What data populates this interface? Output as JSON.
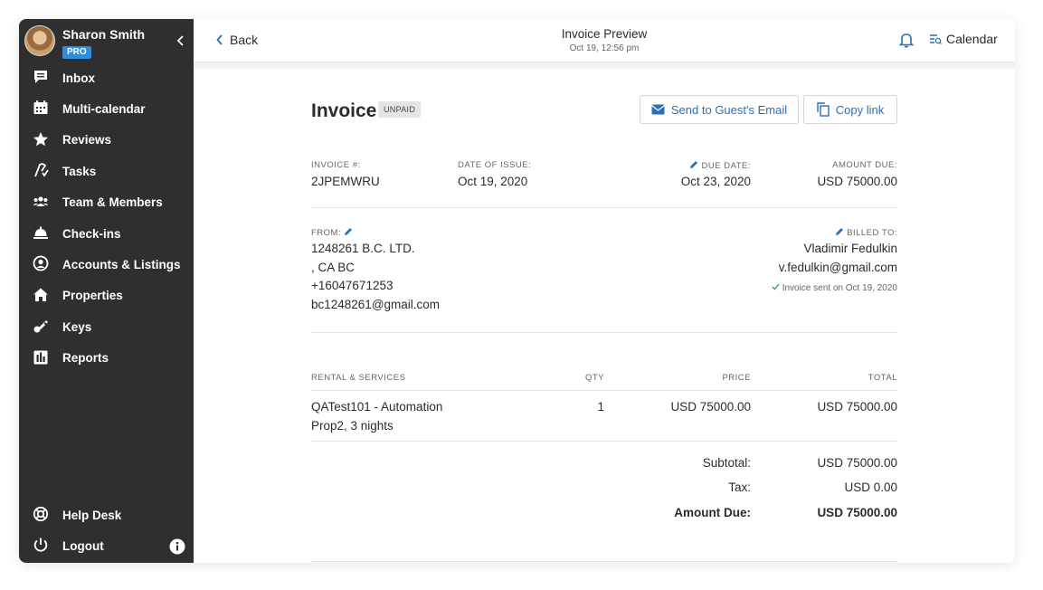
{
  "sidebar": {
    "user_name": "Sharon Smith",
    "plan_badge": "PRO",
    "items": [
      {
        "label": "Inbox",
        "icon": "chat-icon"
      },
      {
        "label": "Multi-calendar",
        "icon": "calendar-icon"
      },
      {
        "label": "Reviews",
        "icon": "star-icon"
      },
      {
        "label": "Tasks",
        "icon": "tasks-icon"
      },
      {
        "label": "Team & Members",
        "icon": "team-icon"
      },
      {
        "label": "Check-ins",
        "icon": "bell-concierge-icon"
      },
      {
        "label": "Accounts & Listings",
        "icon": "account-icon"
      },
      {
        "label": "Properties",
        "icon": "home-icon"
      },
      {
        "label": "Keys",
        "icon": "key-icon"
      },
      {
        "label": "Reports",
        "icon": "reports-icon"
      }
    ],
    "help_desk": "Help Desk",
    "logout": "Logout"
  },
  "topbar": {
    "back": "Back",
    "title": "Invoice Preview",
    "subtitle": "Oct 19, 12:56 pm",
    "calendar": "Calendar"
  },
  "invoice": {
    "title": "Invoice",
    "status": "UNPAID",
    "send_email_button": "Send to Guest's Email",
    "copy_link_button": "Copy link",
    "number_label": "INVOICE #:",
    "number": "2JPEMWRU",
    "issue_label": "DATE OF ISSUE:",
    "issue_date": "Oct 19, 2020",
    "due_label": "DUE DATE:",
    "due_date": "Oct 23, 2020",
    "amount_label": "AMOUNT DUE:",
    "amount": "USD 75000.00",
    "from_label": "FROM:",
    "from_lines": [
      "1248261 B.C. LTD.",
      ", CA BC",
      "+16047671253",
      "bc1248261@gmail.com"
    ],
    "billed_label": "BILLED TO:",
    "billed_name": "Vladimir Fedulkin",
    "billed_email": "v.fedulkin@gmail.com",
    "sent_note": "Invoice sent on Oct 19, 2020",
    "table_headers": {
      "item": "RENTAL & SERVICES",
      "qty": "QTY",
      "price": "PRICE",
      "total": "TOTAL"
    },
    "rows": [
      {
        "item_line1": "QATest101 - Automation",
        "item_line2": "Prop2, 3 nights",
        "qty": "1",
        "price": "USD 75000.00",
        "total": "USD 75000.00"
      }
    ],
    "subtotal_label": "Subtotal:",
    "subtotal": "USD 75000.00",
    "tax_label": "Tax:",
    "tax": "USD 0.00",
    "amount_due_label": "Amount Due:",
    "amount_due": "USD 75000.00"
  },
  "colors": {
    "sidebar_bg": "#2f2f2f",
    "accent": "#2b6fb8",
    "pro_badge": "#2f8fdc"
  }
}
